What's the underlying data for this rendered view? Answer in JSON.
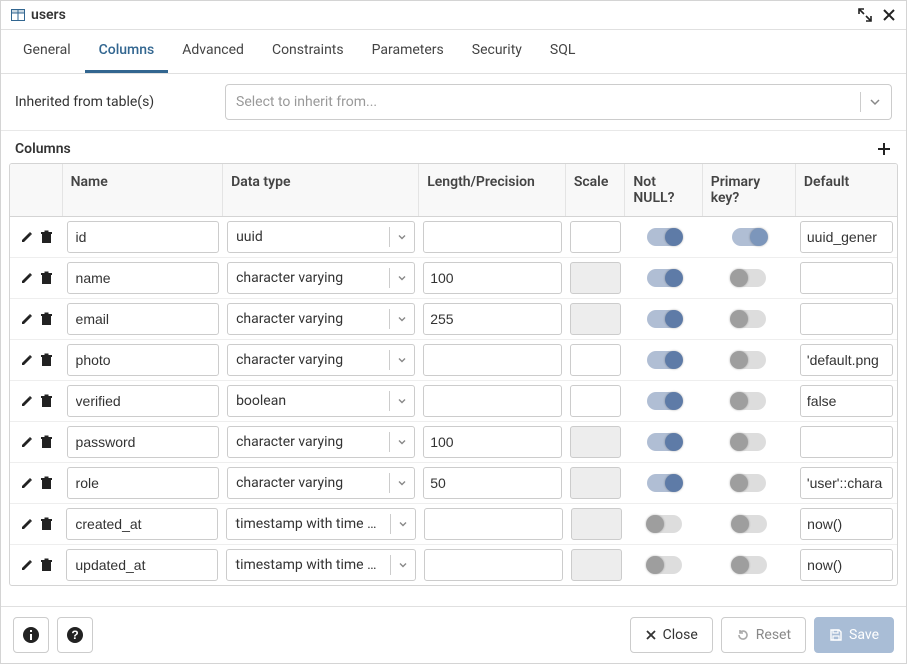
{
  "window": {
    "title": "users"
  },
  "tabs": [
    "General",
    "Columns",
    "Advanced",
    "Constraints",
    "Parameters",
    "Security",
    "SQL"
  ],
  "activeTab": "Columns",
  "inherit": {
    "label": "Inherited from table(s)",
    "placeholder": "Select to inherit from..."
  },
  "section": {
    "title": "Columns"
  },
  "headers": {
    "name": "Name",
    "datatype": "Data type",
    "length": "Length/Precision",
    "scale": "Scale",
    "notnull": "Not NULL?",
    "pk": "Primary key?",
    "default": "Default"
  },
  "rows": [
    {
      "name": "id",
      "datatype": "uuid",
      "length": "",
      "scale": "",
      "scaleDisabled": false,
      "notnull": true,
      "pk": true,
      "pkLight": true,
      "default": "uuid_gener"
    },
    {
      "name": "name",
      "datatype": "character varying",
      "length": "100",
      "scale": "",
      "scaleDisabled": true,
      "notnull": true,
      "pk": false,
      "pkLight": false,
      "default": ""
    },
    {
      "name": "email",
      "datatype": "character varying",
      "length": "255",
      "scale": "",
      "scaleDisabled": true,
      "notnull": true,
      "pk": false,
      "pkLight": false,
      "default": ""
    },
    {
      "name": "photo",
      "datatype": "character varying",
      "length": "",
      "scale": "",
      "scaleDisabled": false,
      "notnull": true,
      "pk": false,
      "pkLight": false,
      "default": "'default.png"
    },
    {
      "name": "verified",
      "datatype": "boolean",
      "length": "",
      "scale": "",
      "scaleDisabled": false,
      "notnull": true,
      "pk": false,
      "pkLight": false,
      "default": "false"
    },
    {
      "name": "password",
      "datatype": "character varying",
      "length": "100",
      "scale": "",
      "scaleDisabled": true,
      "notnull": true,
      "pk": false,
      "pkLight": false,
      "default": ""
    },
    {
      "name": "role",
      "datatype": "character varying",
      "length": "50",
      "scale": "",
      "scaleDisabled": true,
      "notnull": true,
      "pk": false,
      "pkLight": false,
      "default": "'user'::chara"
    },
    {
      "name": "created_at",
      "datatype": "timestamp with time z...",
      "length": "",
      "scale": "",
      "scaleDisabled": true,
      "notnull": false,
      "pk": false,
      "pkLight": false,
      "default": "now()"
    },
    {
      "name": "updated_at",
      "datatype": "timestamp with time z...",
      "length": "",
      "scale": "",
      "scaleDisabled": true,
      "notnull": false,
      "pk": false,
      "pkLight": false,
      "default": "now()"
    }
  ],
  "footer": {
    "close": "Close",
    "reset": "Reset",
    "save": "Save"
  }
}
